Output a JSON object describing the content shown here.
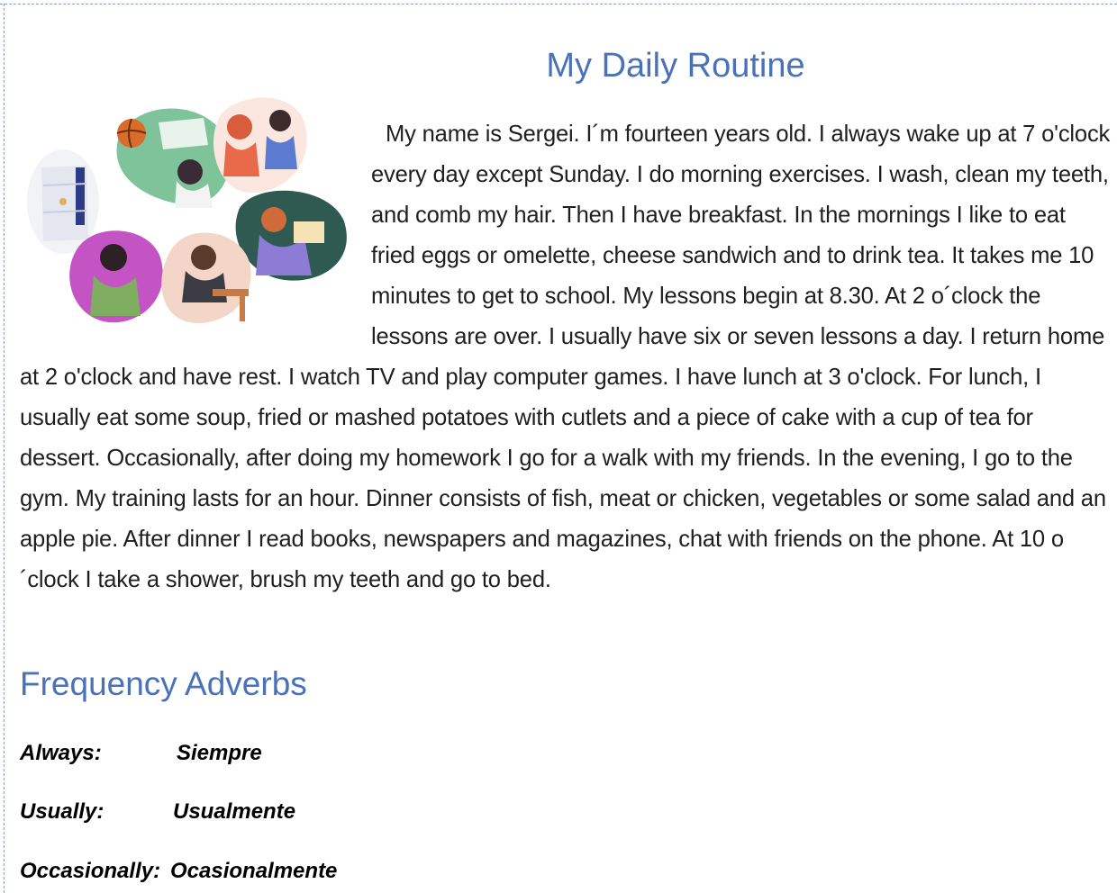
{
  "title": "My Daily Routine",
  "paragraph": "My name is Sergei. I´m fourteen years old. I always wake up at 7 o'clock every day except Sunday. I do morning exercises. I wash, clean my teeth, and comb my hair. Then I have breakfast. In the mornings I like to eat fried eggs or omelette, cheese sandwich and to drink tea. It takes me 10 minutes to get to school. My lessons begin at 8.30. At 2 o´clock the lessons are over. I usually have six or seven lessons a day. I return home at 2 o'clock and have rest. I watch TV and play computer games. I have lunch at 3 o'clock. For lunch, I usually eat some soup, fried or mashed potatoes with cutlets and a piece of cake with a cup of tea for dessert. Occasionally, after doing my homework I go for a walk with my friends. In the evening, I go to the gym. My training lasts for an hour. Dinner consists of fish, meat or chicken, vegetables or some salad and an apple pie. After dinner I read books, newspapers and magazines, chat with friends on the phone. At 10 o´clock I take a shower, brush my teeth and go to bed.",
  "section_title": "Frequency Adverbs",
  "adverbs": [
    {
      "english": "Always:",
      "spanish": "Siempre"
    },
    {
      "english": "Usually:",
      "spanish": "Usualmente"
    },
    {
      "english": "Occasionally:",
      "spanish": "Ocasionalmente"
    }
  ],
  "colors": {
    "heading": "#4a72b8",
    "text": "#1f1f1f"
  }
}
